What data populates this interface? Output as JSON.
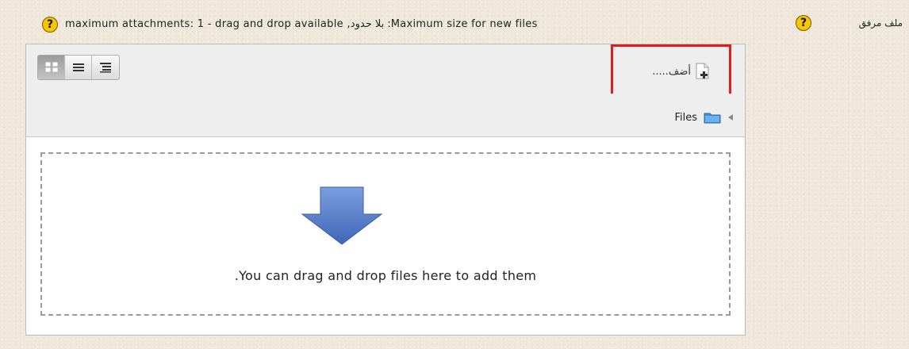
{
  "field": {
    "label": "ملف مرفق",
    "restrictions": "maximum attachments: 1 - drag and drop available ,بلا حدود :Maximum size for new files"
  },
  "help_icon": "?",
  "toolbar": {
    "add_label": "أضف.....",
    "views": [
      "icons-view",
      "list-view",
      "tree-view"
    ],
    "active_view": "icons-view"
  },
  "path": {
    "current": "Files"
  },
  "dropzone": {
    "message": ".You can drag and drop files here to add them"
  },
  "colors": {
    "highlight": "#e11d1d",
    "arrow": "#5b82cf",
    "help": "#f7c600"
  }
}
